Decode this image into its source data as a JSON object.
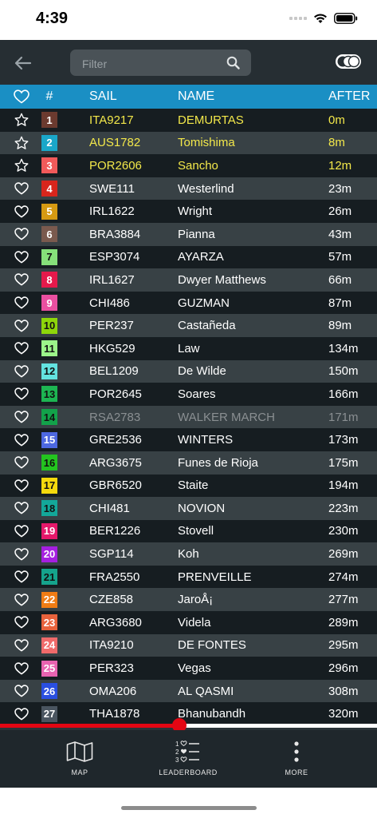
{
  "status": {
    "time": "4:39"
  },
  "filter": {
    "placeholder": "Filter"
  },
  "header": {
    "sail": "SAIL",
    "name": "NAME",
    "after": "AFTER",
    "num": "#"
  },
  "rows": [
    {
      "rank": "1",
      "sail": "ITA9217",
      "name": "DEMURTAS",
      "after": "0m",
      "color": "#6b3a2f",
      "fav": "star",
      "style": "top3"
    },
    {
      "rank": "2",
      "sail": "AUS1782",
      "name": "Tomishima",
      "after": "8m",
      "color": "#1aa7c9",
      "fav": "star",
      "style": "top3"
    },
    {
      "rank": "3",
      "sail": "POR2606",
      "name": "Sancho",
      "after": "12m",
      "color": "#f05a5a",
      "fav": "star",
      "style": "top3"
    },
    {
      "rank": "4",
      "sail": "SWE111",
      "name": "Westerlind",
      "after": "23m",
      "color": "#d8261c",
      "fav": "heart",
      "style": ""
    },
    {
      "rank": "5",
      "sail": "IRL1622",
      "name": "Wright",
      "after": "26m",
      "color": "#d69a12",
      "fav": "heart",
      "style": ""
    },
    {
      "rank": "6",
      "sail": "BRA3884",
      "name": "Pianna",
      "after": "43m",
      "color": "#7a5a4e",
      "fav": "heart",
      "style": ""
    },
    {
      "rank": "7",
      "sail": "ESP3074",
      "name": "AYARZA",
      "after": "57m",
      "color": "#86e07a",
      "fav": "heart",
      "style": "",
      "dark": true
    },
    {
      "rank": "8",
      "sail": "IRL1627",
      "name": "Dwyer Matthews",
      "after": "66m",
      "color": "#e5194b",
      "fav": "heart",
      "style": ""
    },
    {
      "rank": "9",
      "sail": "CHI486",
      "name": "GUZMAN",
      "after": "87m",
      "color": "#ea4fa0",
      "fav": "heart",
      "style": ""
    },
    {
      "rank": "10",
      "sail": "PER237",
      "name": "Castañeda",
      "after": "89m",
      "color": "#8ed60a",
      "fav": "heart",
      "style": "",
      "dark": true
    },
    {
      "rank": "11",
      "sail": "HKG529",
      "name": "Law",
      "after": "134m",
      "color": "#9cf58a",
      "fav": "heart",
      "style": "",
      "dark": true
    },
    {
      "rank": "12",
      "sail": "BEL1209",
      "name": "De Wilde",
      "after": "150m",
      "color": "#63e3e0",
      "fav": "heart",
      "style": "",
      "dark": true
    },
    {
      "rank": "13",
      "sail": "POR2645",
      "name": "Soares",
      "after": "166m",
      "color": "#1db552",
      "fav": "heart",
      "style": "",
      "dark": true
    },
    {
      "rank": "14",
      "sail": "RSA2783",
      "name": "WALKER MARCH",
      "after": "171m",
      "color": "#12a24a",
      "fav": "heart",
      "style": "dim",
      "dark": true
    },
    {
      "rank": "15",
      "sail": "GRE2536",
      "name": "WINTERS",
      "after": "173m",
      "color": "#4d68e0",
      "fav": "heart",
      "style": ""
    },
    {
      "rank": "16",
      "sail": "ARG3675",
      "name": "Funes de Rioja",
      "after": "175m",
      "color": "#23c41f",
      "fav": "heart",
      "style": "",
      "dark": true
    },
    {
      "rank": "17",
      "sail": "GBR6520",
      "name": "Staite",
      "after": "194m",
      "color": "#f5d90d",
      "fav": "heart",
      "style": "",
      "dark": true
    },
    {
      "rank": "18",
      "sail": "CHI481",
      "name": "NOVION",
      "after": "223m",
      "color": "#13a89a",
      "fav": "heart",
      "style": "",
      "dark": true
    },
    {
      "rank": "19",
      "sail": "BER1226",
      "name": "Stovell",
      "after": "230m",
      "color": "#e5186a",
      "fav": "heart",
      "style": ""
    },
    {
      "rank": "20",
      "sail": "SGP114",
      "name": "Koh",
      "after": "269m",
      "color": "#a51fe0",
      "fav": "heart",
      "style": ""
    },
    {
      "rank": "21",
      "sail": "FRA2550",
      "name": "PRENVEILLE",
      "after": "274m",
      "color": "#15a38c",
      "fav": "heart",
      "style": "",
      "dark": true
    },
    {
      "rank": "22",
      "sail": "CZE858",
      "name": "JaroÅ¡",
      "after": "277m",
      "color": "#f07c14",
      "fav": "heart",
      "style": ""
    },
    {
      "rank": "23",
      "sail": "ARG3680",
      "name": "Videla",
      "after": "289m",
      "color": "#e8623c",
      "fav": "heart",
      "style": ""
    },
    {
      "rank": "24",
      "sail": "ITA9210",
      "name": "DE FONTES",
      "after": "295m",
      "color": "#f06a6a",
      "fav": "heart",
      "style": ""
    },
    {
      "rank": "25",
      "sail": "PER323",
      "name": "Vegas",
      "after": "296m",
      "color": "#e863b0",
      "fav": "heart",
      "style": ""
    },
    {
      "rank": "26",
      "sail": "OMA206",
      "name": "AL QASMI",
      "after": "308m",
      "color": "#2a4fe0",
      "fav": "heart",
      "style": ""
    },
    {
      "rank": "27",
      "sail": "THA1878",
      "name": "Bhanubandh",
      "after": "320m",
      "color": "#4a5560",
      "fav": "heart",
      "style": ""
    }
  ],
  "progress": {
    "fraction": 0.475,
    "track_color": "#ffffff",
    "fill_color": "#e30613"
  },
  "nav": {
    "map": "MAP",
    "leaderboard": "LEADERBOARD",
    "more": "MORE"
  },
  "colors": {
    "header_bg": "#1a8fc4",
    "app_bg": "#2a3338",
    "top3_text": "#f3e84a"
  }
}
